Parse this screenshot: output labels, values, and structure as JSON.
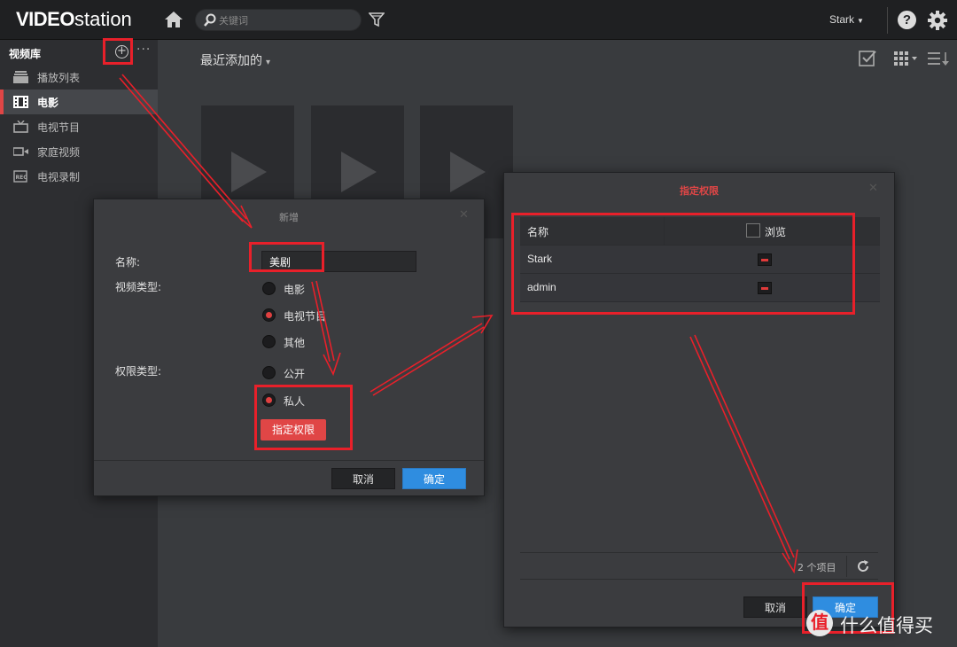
{
  "app": {
    "logo_bold": "VIDEO",
    "logo_rest": "station",
    "search_placeholder": "关键词",
    "user": "Stark",
    "help": "?"
  },
  "sidebar": {
    "title": "视频库",
    "add": "+",
    "more": "···",
    "items": [
      {
        "label": "播放列表",
        "icon": "playlist-icon"
      },
      {
        "label": "电影",
        "icon": "movie-icon",
        "active": true
      },
      {
        "label": "电视节目",
        "icon": "tv-icon"
      },
      {
        "label": "家庭视频",
        "icon": "home-video-icon"
      },
      {
        "label": "电视录制",
        "icon": "tv-recording-icon"
      }
    ]
  },
  "main": {
    "title": "最近添加的",
    "chevron": "⌄"
  },
  "dialog_new": {
    "title": "新增",
    "close": "✕",
    "name_label": "名称:",
    "name_value": "美剧",
    "video_type_label": "视频类型:",
    "video_types": [
      "电影",
      "电视节目",
      "其他"
    ],
    "video_type_selected": "电视节目",
    "permission_type_label": "权限类型:",
    "permission_types": [
      "公开",
      "私人"
    ],
    "permission_type_selected": "私人",
    "assign_permission_button": "指定权限",
    "cancel_button": "取消",
    "ok_button": "确定"
  },
  "dialog_permission": {
    "title": "指定权限",
    "close": "✕",
    "columns": [
      "名称",
      "浏览"
    ],
    "rows": [
      {
        "name": "Stark",
        "browse": "denied"
      },
      {
        "name": "admin",
        "browse": "denied"
      }
    ],
    "count": "2 个项目",
    "cancel_button": "取消",
    "ok_button": "确定"
  },
  "watermark": {
    "mark": "值",
    "text": "什么值得买"
  },
  "colors": {
    "accent_red": "#e04646",
    "primary_blue": "#2f8de0",
    "annotation_red": "#e8202a",
    "topbar": "#1f2022",
    "sidebar": "#2d2e31"
  }
}
